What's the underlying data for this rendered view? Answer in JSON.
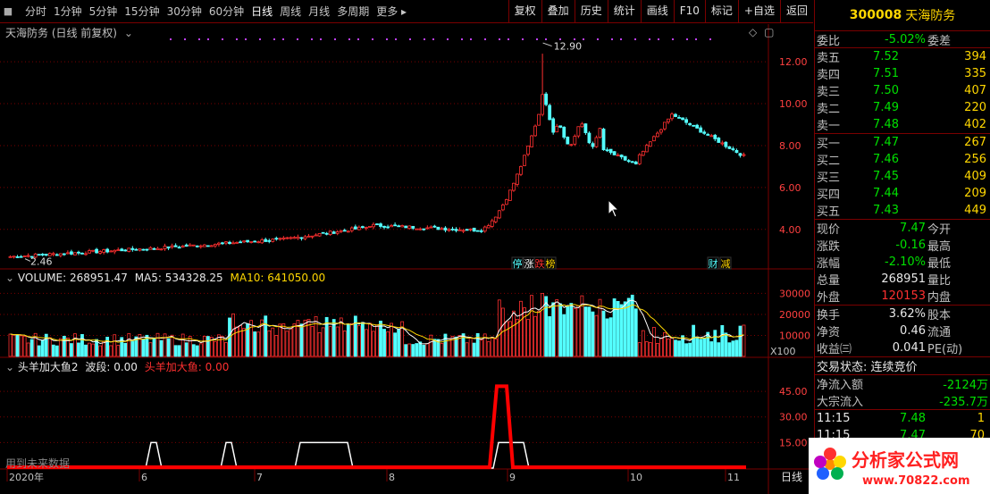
{
  "toolbar": {
    "periods": [
      "分时",
      "1分钟",
      "5分钟",
      "15分钟",
      "30分钟",
      "60分钟",
      "日线",
      "周线",
      "月线",
      "多周期",
      "更多"
    ],
    "active_period": "日线",
    "buttons": [
      "复权",
      "叠加",
      "历史",
      "统计",
      "画线",
      "F10",
      "标记",
      "+自选",
      "返回"
    ]
  },
  "main_panel": {
    "title": "天海防务 (日线 前复权)",
    "max_label": "12.90",
    "min_label": "2.46",
    "y_ticks": [
      "12.00",
      "10.00",
      "8.00",
      "6.00",
      "4.00"
    ],
    "event_tags": [
      "停",
      "涨",
      "跌",
      "榜",
      "财",
      "减"
    ]
  },
  "volume_panel": {
    "label": "VOLUME: 268951.47",
    "ma5": "MA5: 534328.25",
    "ma10": "MA10: 641050.00",
    "y_ticks": [
      "30000",
      "20000",
      "10000"
    ],
    "unit": "X100"
  },
  "indicator_panel": {
    "name": "头羊加大鱼2",
    "wave": "波段: 0.00",
    "line_label": "头羊加大鱼: 0.00",
    "y_ticks": [
      "45.00",
      "30.00",
      "15.00"
    ],
    "note": "用到未来数据"
  },
  "x_axis": {
    "labels": [
      "2020年",
      "6",
      "7",
      "8",
      "9",
      "10",
      "11"
    ],
    "period": "日线"
  },
  "quote": {
    "code": "300008",
    "name": "天海防务",
    "weibi": {
      "label": "委比",
      "value": "-5.02%",
      "label2": "委差"
    },
    "asks": [
      {
        "label": "卖五",
        "price": "7.52",
        "vol": "394"
      },
      {
        "label": "卖四",
        "price": "7.51",
        "vol": "335"
      },
      {
        "label": "卖三",
        "price": "7.50",
        "vol": "407"
      },
      {
        "label": "卖二",
        "price": "7.49",
        "vol": "220"
      },
      {
        "label": "卖一",
        "price": "7.48",
        "vol": "402"
      }
    ],
    "bids": [
      {
        "label": "买一",
        "price": "7.47",
        "vol": "267"
      },
      {
        "label": "买二",
        "price": "7.46",
        "vol": "256"
      },
      {
        "label": "买三",
        "price": "7.45",
        "vol": "409"
      },
      {
        "label": "买四",
        "price": "7.44",
        "vol": "209"
      },
      {
        "label": "买五",
        "price": "7.43",
        "vol": "449"
      }
    ],
    "stats1": [
      {
        "l1": "现价",
        "v1": "7.47",
        "l2": "今开",
        "cls": "green"
      },
      {
        "l1": "涨跌",
        "v1": "-0.16",
        "l2": "最高",
        "cls": "green"
      },
      {
        "l1": "涨幅",
        "v1": "-2.10%",
        "l2": "最低",
        "cls": "green"
      },
      {
        "l1": "总量",
        "v1": "268951",
        "l2": "量比",
        "cls": "white"
      },
      {
        "l1": "外盘",
        "v1": "120153",
        "l2": "内盘",
        "cls": "red"
      }
    ],
    "stats2": [
      {
        "l1": "换手",
        "v1": "3.62%",
        "l2": "股本"
      },
      {
        "l1": "净资",
        "v1": "0.46",
        "l2": "流通"
      },
      {
        "l1": "收益㈢",
        "v1": "0.041",
        "l2": "PE(动)"
      }
    ],
    "trade_status": "交易状态: 连续竞价",
    "flows": [
      {
        "label": "净流入额",
        "value": "-2124万"
      },
      {
        "label": "大宗流入",
        "value": "-235.7万"
      }
    ],
    "ticks": [
      {
        "time": "11:15",
        "price": "7.48",
        "vol": "1"
      },
      {
        "time": "11:15",
        "price": "7.47",
        "vol": "70"
      }
    ]
  },
  "colors": {
    "up": "#ff3030",
    "down": "#54ffff",
    "grid": "#7a0000",
    "signal": "#ff0000"
  }
}
